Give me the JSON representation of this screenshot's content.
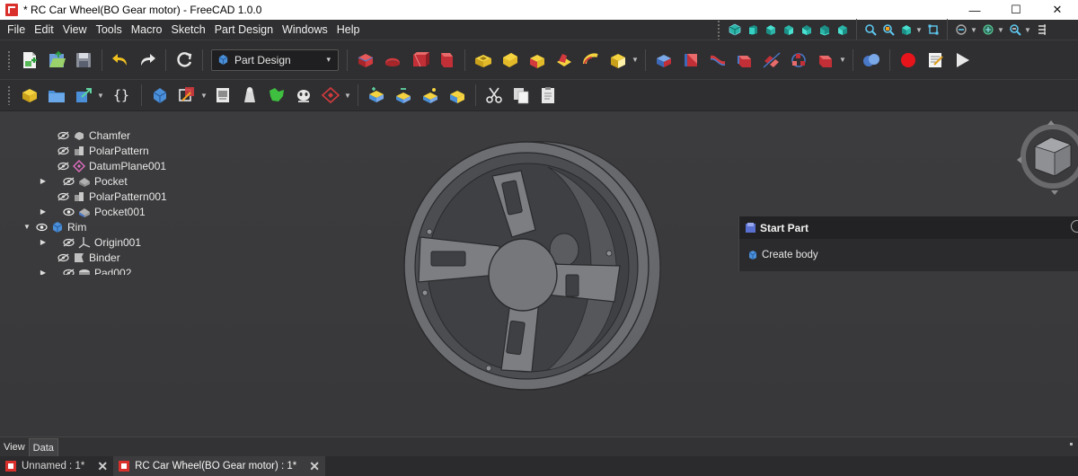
{
  "window": {
    "title": "* RC Car Wheel(BO Gear motor) - FreeCAD 1.0.0",
    "minimize": "—",
    "maximize": "☐",
    "close": "✕"
  },
  "menu": {
    "items": [
      "File",
      "Edit",
      "View",
      "Tools",
      "Macro",
      "Sketch",
      "Part Design",
      "Windows",
      "Help"
    ]
  },
  "workbench": {
    "selected": "Part Design",
    "chevron": "▾"
  },
  "tree": {
    "items": [
      {
        "label": "Chamfer",
        "expand": "",
        "icon": "chamfer-icon"
      },
      {
        "label": "PolarPattern",
        "expand": "",
        "icon": "polar-pattern-icon"
      },
      {
        "label": "DatumPlane001",
        "expand": "",
        "icon": "datum-plane-icon"
      },
      {
        "label": "Pocket",
        "expand": "▶",
        "icon": "pocket-icon"
      },
      {
        "label": "PolarPattern001",
        "expand": "",
        "icon": "polar-pattern-icon"
      },
      {
        "label": "Pocket001",
        "expand": "▶",
        "icon": "pocket-icon"
      },
      {
        "label": "Rim",
        "expand": "▼",
        "icon": "body-icon"
      },
      {
        "label": "Origin001",
        "expand": "▶",
        "icon": "origin-icon"
      },
      {
        "label": "Binder",
        "expand": "",
        "icon": "binder-icon"
      },
      {
        "label": "Pad002",
        "expand": "▶",
        "icon": "pad-icon"
      }
    ]
  },
  "task_panel": {
    "title": "Start Part",
    "action": "Create body"
  },
  "combo_tabs": {
    "view": "View",
    "data": "Data"
  },
  "documents": {
    "tabs": [
      {
        "label": "Unnamed : 1*",
        "close": "✕"
      },
      {
        "label": "RC Car Wheel(BO Gear motor) : 1*",
        "close": "✕"
      }
    ]
  },
  "colors": {
    "background": "#3a3a3c",
    "toolbar": "#2f2f31",
    "accent_red": "#d9302c",
    "model_gray": "#6b6d71"
  }
}
